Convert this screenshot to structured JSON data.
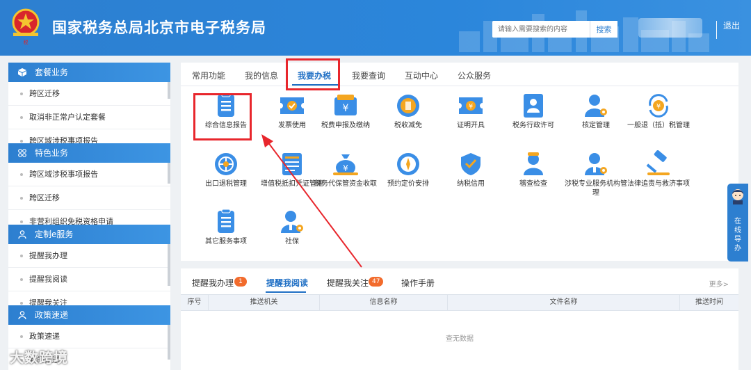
{
  "header": {
    "title": "国家税务总局北京市电子税务局",
    "search_placeholder": "请输入需要搜索的内容",
    "search_button": "搜索",
    "logout": "退出",
    "accent": "#2d7fd0"
  },
  "sidebar": {
    "sections": [
      {
        "title": "套餐业务",
        "items": [
          "跨区迁移",
          "取消非正常户认定套餐",
          "跨区域涉税事项报告"
        ]
      },
      {
        "title": "特色业务",
        "items": [
          "跨区域涉税事项报告",
          "跨区迁移",
          "非营利组织免税资格申请"
        ]
      },
      {
        "title": "定制e服务",
        "items": [
          "提醒我办理",
          "提醒我阅读",
          "提醒我关注"
        ]
      },
      {
        "title": "政策速递",
        "items": [
          "政策速递",
          "我的推送"
        ]
      }
    ]
  },
  "tabs": [
    "常用功能",
    "我的信息",
    "我要办税",
    "我要查询",
    "互动中心",
    "公众服务"
  ],
  "active_tab": "我要办税",
  "services": [
    {
      "label": "综合信息报告",
      "icon": "report-doc-icon"
    },
    {
      "label": "发票使用",
      "icon": "ticket-icon"
    },
    {
      "label": "税费申报及缴纳",
      "icon": "wallet-yuan-icon"
    },
    {
      "label": "税收减免",
      "icon": "coin-icon"
    },
    {
      "label": "证明开具",
      "icon": "certificate-icon"
    },
    {
      "label": "税务行政许可",
      "icon": "license-person-icon"
    },
    {
      "label": "核定管理",
      "icon": "user-gear-icon"
    },
    {
      "label": "一般退（抵）税管理",
      "icon": "refund-cycle-icon"
    },
    {
      "label": "出口退税管理",
      "icon": "globe-icon"
    },
    {
      "label": "增值税抵扣凭证管理",
      "icon": "voucher-icon"
    },
    {
      "label": "税务代保管资金收取",
      "icon": "money-bag-icon"
    },
    {
      "label": "预约定价安排",
      "icon": "compass-icon"
    },
    {
      "label": "纳税信用",
      "icon": "shield-icon"
    },
    {
      "label": "稽查检查",
      "icon": "inspector-icon"
    },
    {
      "label": "涉税专业服务机构管理",
      "icon": "agent-gear-icon"
    },
    {
      "label": "法律追责与救济事项",
      "icon": "gavel-icon"
    },
    {
      "label": "其它服务事项",
      "icon": "doc-list-icon"
    },
    {
      "label": "社保",
      "icon": "social-security-icon"
    }
  ],
  "reminders": {
    "tabs": [
      {
        "label": "提醒我办理",
        "badge": "1"
      },
      {
        "label": "提醒我阅读",
        "badge": ""
      },
      {
        "label": "提醒我关注",
        "badge": "47"
      },
      {
        "label": "操作手册",
        "badge": ""
      }
    ],
    "more": "更多>",
    "columns": [
      "序号",
      "推送机关",
      "信息名称",
      "文件名称",
      "推送时间"
    ],
    "empty": "查无数据"
  },
  "side_guide": "在线导办",
  "watermark": "大数跨境",
  "highlight_color": "#e8262c"
}
